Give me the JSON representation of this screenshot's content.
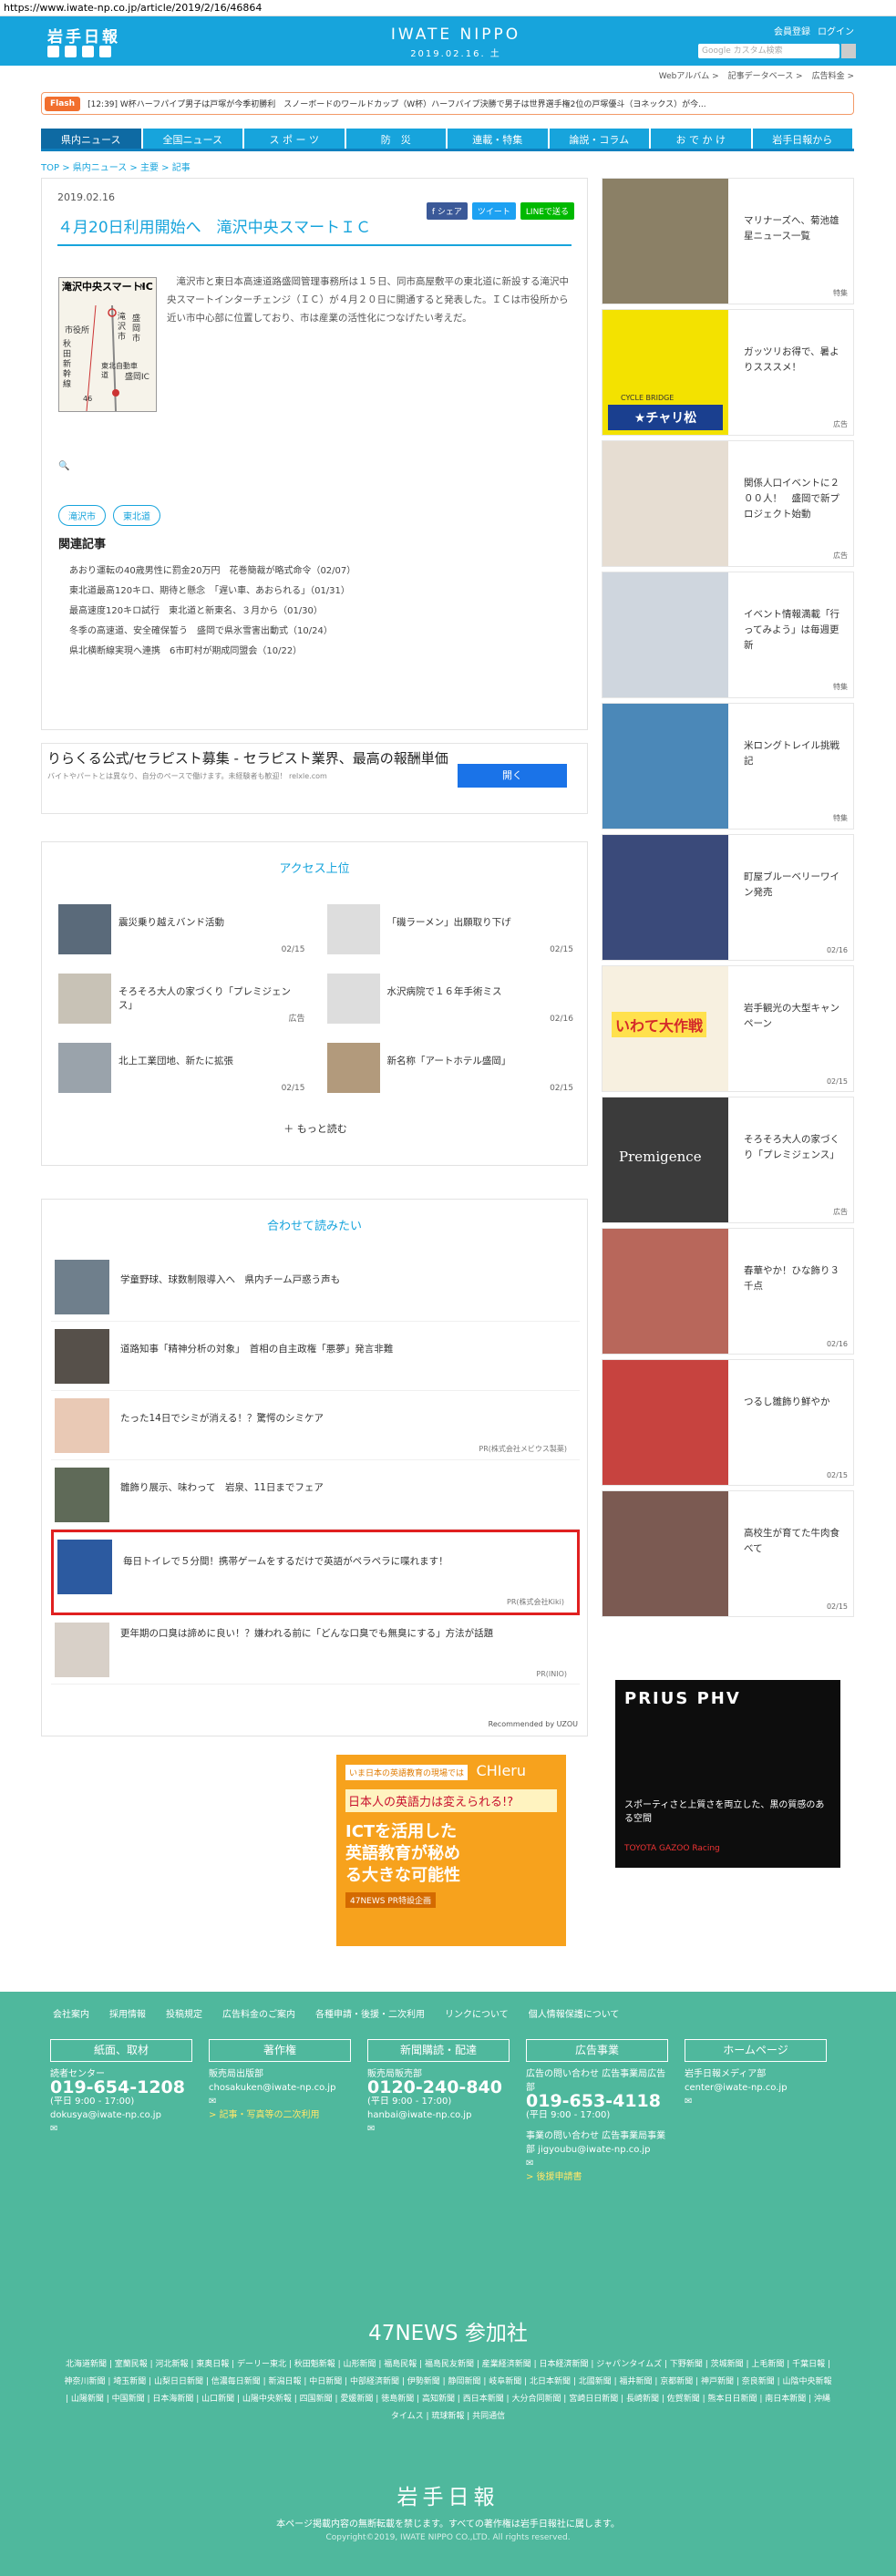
{
  "url": "https://www.iwate-np.co.jp/article/2019/2/16/46864",
  "header": {
    "logo": "岩手日報",
    "brand": "IWATE NIPPO",
    "date": "2019.02.16. 土",
    "links": [
      "会員登録",
      "ログイン"
    ],
    "search_placeholder": "Google カスタム検索",
    "sublinks": [
      "Webアルバム >",
      "記事データベース >",
      "広告料金 >"
    ]
  },
  "flash": {
    "label": "Flash",
    "text": "[12:39] W杯ハーフパイプ男子は戸塚が今季初勝利　スノーボードのワールドカップ（W杯）ハーフパイプ決勝で男子は世界選手権2位の戸塚優斗（ヨネックス）が今..."
  },
  "nav": [
    "県内ニュース",
    "全国ニュース",
    "ス ポ ー ツ",
    "防　災",
    "連載・特集",
    "論説・コラム",
    "お で か け",
    "岩手日報から"
  ],
  "breadcrumb": "TOP > 県内ニュース > 主要 > 記事",
  "article": {
    "date": "2019.02.16",
    "share": [
      "f シェア",
      "ツイート",
      "LINEで送る"
    ],
    "title": "４月20日利用開始へ　滝沢中央スマートＩＣ",
    "map_title": "滝沢中央スマートIC",
    "map_labels": [
      "市役所",
      "秋田新幹線",
      "滝沢市",
      "盛岡市",
      "東北自動車道",
      "盛岡IC",
      "46",
      "N"
    ],
    "body": "　滝沢市と東日本高速道路盛岡管理事務所は１５日、同市高屋敷平の東北道に新設する滝沢中央スマートインターチェンジ（ＩＣ）が４月２０日に開通すると発表した。ＩＣは市役所から近い市中心部に位置しており、市は産業の活性化につなげたい考えだ。",
    "tags": [
      "滝沢市",
      "東北道"
    ],
    "related_heading": "関連記事",
    "related": [
      "あおり運転の40歳男性に罰金20万円　花巻簡裁が略式命令（02/07）",
      "東北道最高120キロ、期待と懸念　「遅い車、あおられる」（01/31）",
      "最高速度120キロ試行　東北道と新東名、３月から（01/30）",
      "冬季の高速道、安全確保誓う　盛岡で県氷雪害出動式（10/24）",
      "県北横断線実現へ連携　6市町村が期成同盟会（10/22）"
    ]
  },
  "ad1": {
    "title": "りらくる公式/セラピスト募集 - セラピスト業界、最高の報酬単価",
    "sub": "バイトやパートとは異なり、自分のペースで働けます。未経験者も歓迎！ relxle.com",
    "button": "開く"
  },
  "ranking": {
    "heading": "アクセス上位",
    "items": [
      {
        "title": "震災乗り越えバンド活動",
        "date": "02/15"
      },
      {
        "title": "「磯ラーメン」出願取り下げ",
        "date": "02/15"
      },
      {
        "title": "そろそろ大人の家づくり「プレミジェンス」",
        "date": "広告"
      },
      {
        "title": "水沢病院で１６年手術ミス",
        "date": "02/16"
      },
      {
        "title": "北上工業団地、新たに拡張",
        "date": "02/15"
      },
      {
        "title": "新名称「アートホテル盛岡」",
        "date": "02/15"
      }
    ],
    "more": "＋ もっと読む"
  },
  "recommend": {
    "heading": "合わせて読みたい",
    "items": [
      {
        "title": "学童野球、球数制限導入へ　県内チーム戸惑う声も",
        "pr": ""
      },
      {
        "title": "道路知事「精神分析の対象」　首相の自主政権「悪夢」発言非難",
        "pr": ""
      },
      {
        "title": "たった14日でシミが消える！？驚愕のシミケア",
        "pr": "PR(株式会社メビウス製薬)"
      },
      {
        "title": "雛飾り展示、味わって　岩泉、11日までフェア",
        "pr": ""
      },
      {
        "title": "毎日トイレで５分間！携帯ゲームをするだけで英語がペラペラに喋れます！",
        "pr": "PR(株式会社Kiki)"
      },
      {
        "title": "更年期の口臭は諦めに良い！？嫌われる前に「どんな口臭でも無臭にする」方法が話題",
        "pr": "PR(INIO)"
      }
    ],
    "credit": "Recommended by UZOU"
  },
  "ad2": {
    "top": "いま日本の英語教育の現場では",
    "brand": "CHIeru",
    "mid": "日本人の英語力は変えられる!?",
    "big": "ICTを活用した英語教育が秘める大きな可能性",
    "bot": "47NEWS PR特設企画"
  },
  "sidebar": [
    {
      "title": "マリナーズへ、菊池雄星ニュース一覧",
      "date": "特集"
    },
    {
      "title": "ガッツリお得で、暑よりスススメ！",
      "date": "広告"
    },
    {
      "title": "関係人口イベントに２００人！　盛岡で新プロジェクト始動",
      "date": "広告"
    },
    {
      "title": "イベント情報満載「行ってみよう」は毎週更新",
      "date": "特集"
    },
    {
      "title": "米ロングトレイル挑戦記",
      "date": "特集"
    },
    {
      "title": "町屋ブルーベリーワイン発売",
      "date": "02/16"
    },
    {
      "title": "岩手観光の大型キャンペーン",
      "date": "02/15"
    },
    {
      "title": "そろそろ大人の家づくり「プレミジェンス」",
      "date": "広告"
    },
    {
      "title": "春華やか！ひな飾り３千点",
      "date": "02/16"
    },
    {
      "title": "つるし雛飾り鮮やか",
      "date": "02/15"
    },
    {
      "title": "高校生が育てた牛肉食べて",
      "date": "02/15"
    }
  ],
  "sidebar_img_labels": [
    "CYCLE BRIDGE",
    "★チャリ松",
    "いわて大作戦",
    "Premigence"
  ],
  "prius": {
    "title": "PRIUS PHV",
    "sub": "スポーティさと上質さを両立した、黒の質感のある空間",
    "brand": "TOYOTA GAZOO Racing"
  },
  "footer": {
    "links": [
      "会社案内",
      "採用情報",
      "投稿規定",
      "広告料金のご案内",
      "各種申請・後援・二次利用",
      "リンクについて",
      "個人情報保護について"
    ],
    "cols": [
      {
        "head": "紙面、取材",
        "l1": "読者センター",
        "phone": "019-654-1208",
        "hours": "(平日 9:00 - 17:00)",
        "mail": "dokusya@iwate-np.co.jp",
        "extra": ""
      },
      {
        "head": "著作権",
        "l1": "販売局出版部",
        "phone": "",
        "hours": "",
        "mail": "chosakuken@iwate-np.co.jp",
        "extra": "> 記事・写真等の二次利用"
      },
      {
        "head": "新聞購読・配達",
        "l1": "販売局販売部",
        "phone": "0120-240-840",
        "hours": "(平日 9:00 - 17:00)",
        "mail": "hanbai@iwate-np.co.jp",
        "extra": ""
      },
      {
        "head": "広告事業",
        "l1": "広告の問い合わせ 広告事業局広告部",
        "phone": "019-653-4118",
        "hours": "(平日 9:00 - 17:00)",
        "mail": "事業の問い合わせ 広告事業局事業部 jigyoubu@iwate-np.co.jp",
        "extra": "> 後援申請書"
      },
      {
        "head": "ホームページ",
        "l1": "岩手日報メディア部",
        "phone": "",
        "hours": "",
        "mail": "center@iwate-np.co.jp",
        "extra": ""
      }
    ],
    "p47": "47NEWS 参加社",
    "papers": "北海道新聞 | 室蘭民報 | 河北新報 | 東奥日報 | デーリー東北 | 秋田魁新報 | 山形新聞 | 福島民報 | 福島民友新聞 | 産業経済新聞 | 日本経済新聞 | ジャパンタイムズ | 下野新聞 | 茨城新聞 | 上毛新聞 | 千葉日報 | 神奈川新聞 | 埼玉新聞 | 山梨日日新聞 | 信濃毎日新聞 | 新潟日報 | 中日新聞 | 中部経済新聞 | 伊勢新聞 | 静岡新聞 | 岐阜新聞 | 北日本新聞 | 北國新聞 | 福井新聞 | 京都新聞 | 神戸新聞 | 奈良新聞 | 山陰中央新報 | 山陽新聞 | 中国新聞 | 日本海新聞 | 山口新聞 | 山陽中央新報 | 四国新聞 | 愛媛新聞 | 徳島新聞 | 高知新聞 | 西日本新聞 | 大分合同新聞 | 宮崎日日新聞 | 長崎新聞 | 佐賀新聞 | 熊本日日新聞 | 南日本新聞 | 沖縄タイムス | 琉球新報 | 共同通信",
    "logo": "岩手日報",
    "note": "本ページ掲載内容の無断転載を禁じます。すべての著作権は岩手日報社に属します。",
    "copy": "Copyright©2019, IWATE NIPPO CO.,LTD. All rights reserved."
  }
}
